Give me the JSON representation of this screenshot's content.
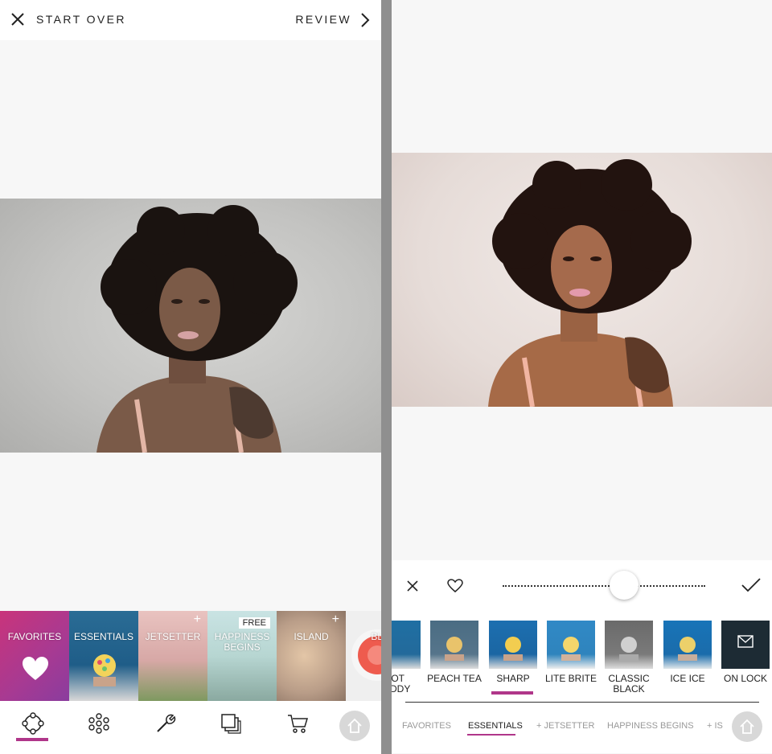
{
  "left": {
    "header": {
      "start_over": "START OVER",
      "review": "REVIEW"
    },
    "packs": [
      {
        "label": "FAVORITES",
        "plus": "",
        "badge": ""
      },
      {
        "label": "ESSENTIALS",
        "plus": "",
        "badge": ""
      },
      {
        "label": "JETSETTER",
        "plus": "+",
        "badge": ""
      },
      {
        "label": "HAPPINESS BEGINS",
        "plus": "",
        "badge": "FREE"
      },
      {
        "label": "ISLAND",
        "plus": "+",
        "badge": ""
      },
      {
        "label": "BLU",
        "plus": "",
        "badge": ""
      }
    ],
    "nav": [
      "filters-icon",
      "effects-icon",
      "tools-icon",
      "layers-icon",
      "cart-icon",
      "home-icon"
    ]
  },
  "right": {
    "filters": [
      {
        "label": "HOT TODDY",
        "display": "IOT\nODDY"
      },
      {
        "label": "PEACH TEA"
      },
      {
        "label": "SHARP"
      },
      {
        "label": "LITE BRITE"
      },
      {
        "label": "CLASSIC BLACK"
      },
      {
        "label": "ICE ICE"
      },
      {
        "label": "ON LOCK"
      }
    ],
    "categories": [
      "FAVORITES",
      "ESSENTIALS",
      "+ JETSETTER",
      "HAPPINESS BEGINS",
      "+ IS"
    ],
    "active_category": "ESSENTIALS",
    "active_filter": "SHARP",
    "intensity": 0.6
  },
  "colors": {
    "accent": "#b0368a",
    "background": "#f7f7f7"
  }
}
